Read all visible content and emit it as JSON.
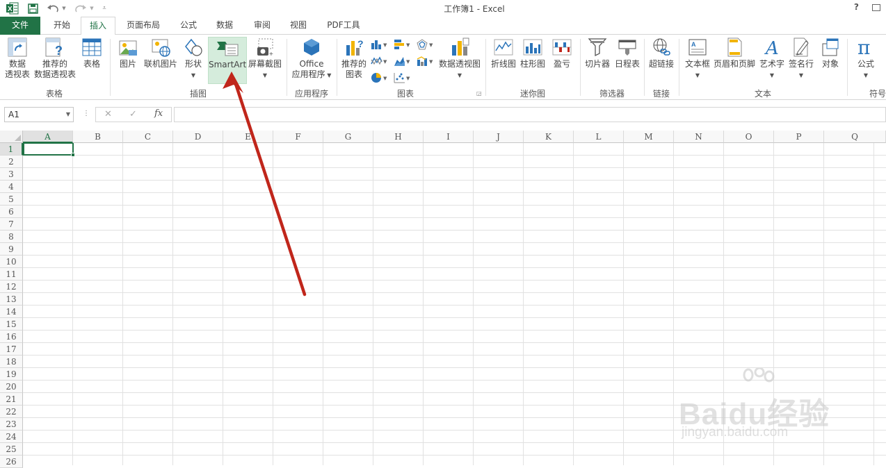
{
  "window": {
    "title": "工作簿1 - Excel",
    "help": "?"
  },
  "tabs": {
    "file": "文件",
    "items": [
      "开始",
      "插入",
      "页面布局",
      "公式",
      "数据",
      "审阅",
      "视图",
      "PDF工具"
    ]
  },
  "ribbon": {
    "pivot_table": [
      "数据",
      "透视表"
    ],
    "recommended_pivot": [
      "推荐的",
      "数据透视表"
    ],
    "table": "表格",
    "picture": "图片",
    "online_picture": "联机图片",
    "shapes": "形状",
    "smartart": "SmartArt",
    "screenshot": "屏幕截图",
    "office_apps": [
      "Office",
      "应用程序"
    ],
    "recommended_charts": [
      "推荐的",
      "图表"
    ],
    "pivot_chart": "数据透视图",
    "spark_line": "折线图",
    "spark_column": "柱形图",
    "spark_winloss": "盈亏",
    "slicer": "切片器",
    "timeline": "日程表",
    "hyperlink": "超链接",
    "textbox": "文本框",
    "header_footer": "页眉和页脚",
    "wordart": "艺术字",
    "signature": "签名行",
    "object": "对象",
    "equation": "公式",
    "groups": {
      "tables": "表格",
      "illustrations": "插图",
      "apps": "应用程序",
      "charts": "图表",
      "sparklines": "迷你图",
      "filters": "筛选器",
      "links": "链接",
      "text": "文本",
      "symbols": "符号"
    }
  },
  "formula_bar": {
    "name_box": "A1",
    "fx": "fx",
    "value": ""
  },
  "sheet": {
    "columns": [
      "A",
      "B",
      "C",
      "D",
      "E",
      "F",
      "G",
      "H",
      "I",
      "J",
      "K",
      "L",
      "M",
      "N",
      "O",
      "P",
      "Q"
    ],
    "rows": [
      "1",
      "2",
      "3",
      "4",
      "5",
      "6",
      "7",
      "8",
      "9",
      "10",
      "11",
      "12",
      "13",
      "14",
      "15",
      "16",
      "17",
      "18",
      "19",
      "20",
      "21",
      "22",
      "23",
      "24",
      "25",
      "26"
    ],
    "active_cell": "A1"
  },
  "watermark": {
    "main": "Baidu经验",
    "sub": "jingyan.baidu.com"
  },
  "colors": {
    "excel_green": "#217346",
    "arrow_red": "#c0261b",
    "highlight": "#d5ecdc"
  }
}
